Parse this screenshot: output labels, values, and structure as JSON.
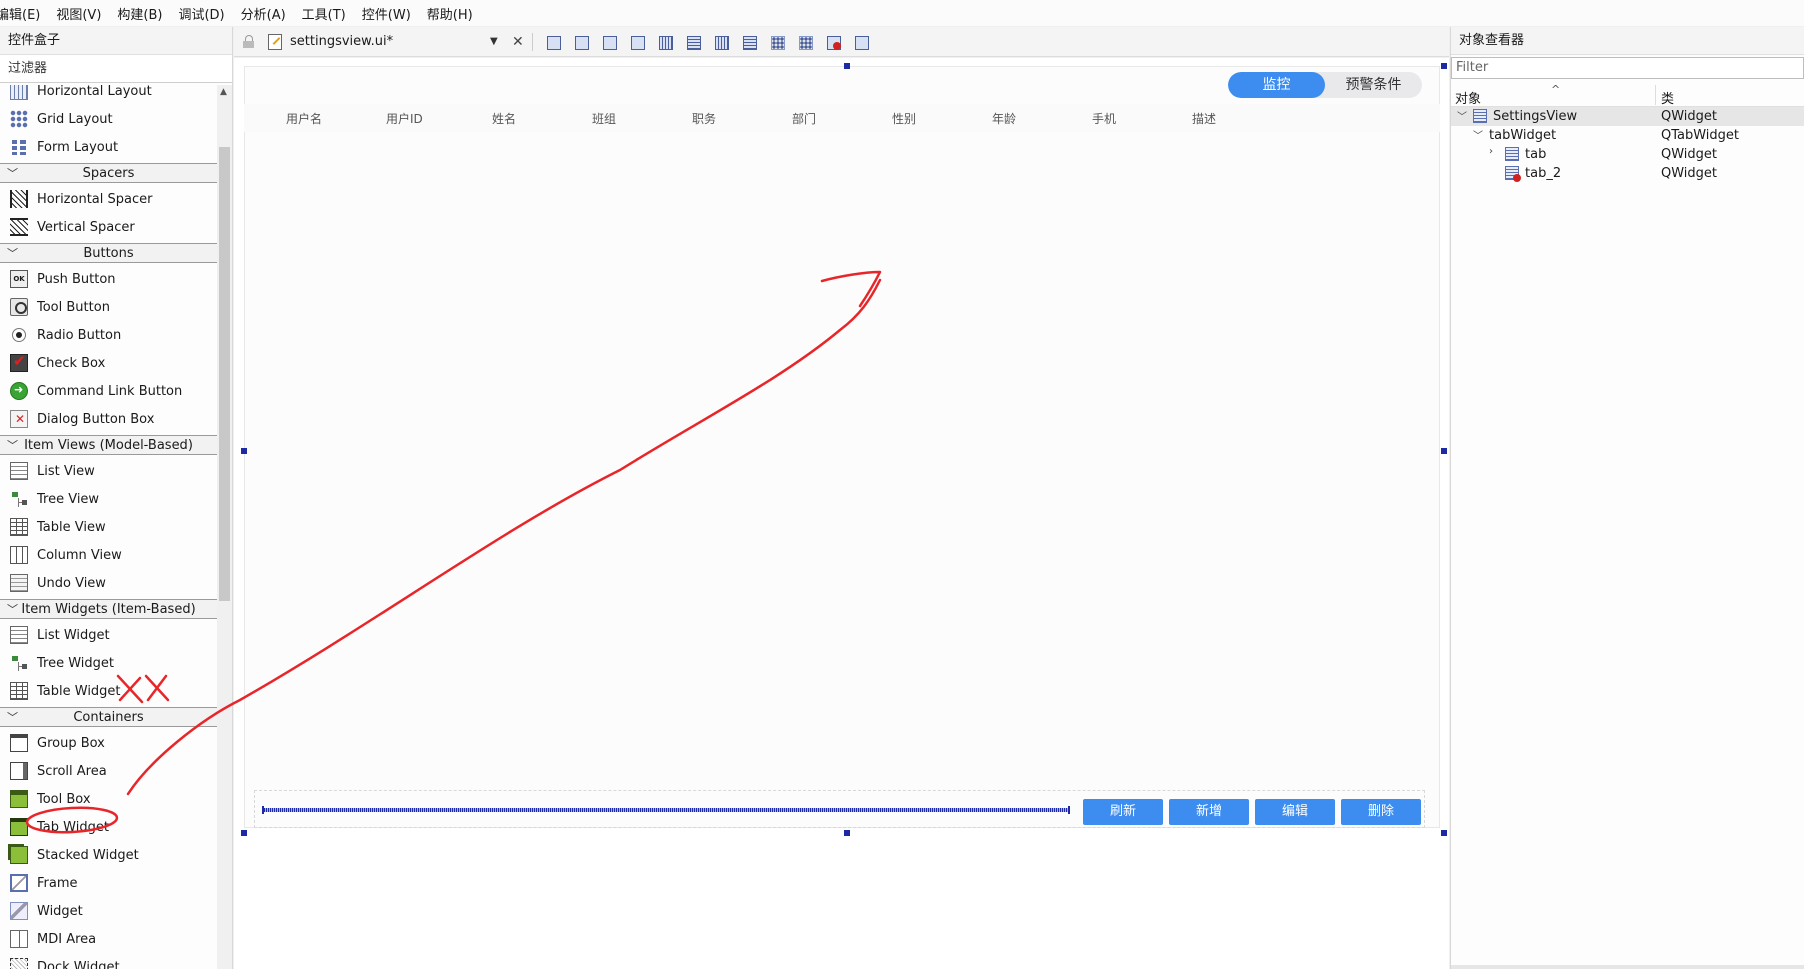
{
  "menubar": {
    "items": [
      "编辑(E)",
      "视图(V)",
      "构建(B)",
      "调试(D)",
      "分析(A)",
      "工具(T)",
      "控件(W)",
      "帮助(H)"
    ]
  },
  "widgetbox": {
    "title": "控件盒子",
    "filter_label": "过滤器",
    "groups": [
      {
        "label": null,
        "items": [
          {
            "label": "Horizontal Layout",
            "icon": "horizontal-layout-icon"
          },
          {
            "label": "Grid Layout",
            "icon": "grid-layout-icon"
          },
          {
            "label": "Form Layout",
            "icon": "form-layout-icon"
          }
        ]
      },
      {
        "label": "Spacers",
        "items": [
          {
            "label": "Horizontal Spacer",
            "icon": "horizontal-spacer-icon"
          },
          {
            "label": "Vertical Spacer",
            "icon": "vertical-spacer-icon"
          }
        ]
      },
      {
        "label": "Buttons",
        "items": [
          {
            "label": "Push Button",
            "icon": "push-button-icon"
          },
          {
            "label": "Tool Button",
            "icon": "tool-button-icon"
          },
          {
            "label": "Radio Button",
            "icon": "radio-button-icon"
          },
          {
            "label": "Check Box",
            "icon": "check-box-icon"
          },
          {
            "label": "Command Link Button",
            "icon": "command-link-icon"
          },
          {
            "label": "Dialog Button Box",
            "icon": "dialog-button-box-icon"
          }
        ]
      },
      {
        "label": "Item Views (Model-Based)",
        "items": [
          {
            "label": "List View",
            "icon": "list-view-icon"
          },
          {
            "label": "Tree View",
            "icon": "tree-view-icon"
          },
          {
            "label": "Table View",
            "icon": "table-view-icon"
          },
          {
            "label": "Column View",
            "icon": "column-view-icon"
          },
          {
            "label": "Undo View",
            "icon": "undo-view-icon"
          }
        ]
      },
      {
        "label": "Item Widgets (Item-Based)",
        "items": [
          {
            "label": "List Widget",
            "icon": "list-widget-icon"
          },
          {
            "label": "Tree Widget",
            "icon": "tree-widget-icon"
          },
          {
            "label": "Table Widget",
            "icon": "table-widget-icon"
          }
        ]
      },
      {
        "label": "Containers",
        "items": [
          {
            "label": "Group Box",
            "icon": "group-box-icon"
          },
          {
            "label": "Scroll Area",
            "icon": "scroll-area-icon"
          },
          {
            "label": "Tool Box",
            "icon": "tool-box-icon"
          },
          {
            "label": "Tab Widget",
            "icon": "tab-widget-icon"
          },
          {
            "label": "Stacked Widget",
            "icon": "stacked-widget-icon"
          },
          {
            "label": "Frame",
            "icon": "frame-icon"
          },
          {
            "label": "Widget",
            "icon": "widget-icon"
          },
          {
            "label": "MDI Area",
            "icon": "mdi-area-icon"
          },
          {
            "label": "Dock Widget",
            "icon": "dock-widget-icon"
          }
        ]
      }
    ]
  },
  "editor": {
    "file_name": "settingsview.ui*"
  },
  "form": {
    "tabs": [
      {
        "label": "监控",
        "active": true
      },
      {
        "label": "预警条件",
        "active": false
      }
    ],
    "columns": [
      "用户名",
      "用户ID",
      "姓名",
      "班组",
      "职务",
      "部门",
      "性别",
      "年龄",
      "手机",
      "描述"
    ],
    "buttons": [
      "刷新",
      "新增",
      "编辑",
      "删除"
    ],
    "accent_color": "#3d8df0",
    "selection_color": "#1c2ba5"
  },
  "inspector": {
    "title": "对象查看器",
    "filter_placeholder": "Filter",
    "col_object": "对象",
    "col_class": "类",
    "tree": [
      {
        "name": "SettingsView",
        "class": "QWidget",
        "depth": 0,
        "arrow": "﹀",
        "selected": true
      },
      {
        "name": "tabWidget",
        "class": "QTabWidget",
        "depth": 1,
        "arrow": "﹀",
        "selected": false
      },
      {
        "name": "tab",
        "class": "QWidget",
        "depth": 2,
        "arrow": "›",
        "selected": false
      },
      {
        "name": "tab_2",
        "class": "QWidget",
        "depth": 2,
        "arrow": "",
        "selected": false
      }
    ]
  },
  "annotation_color": "#e8262a"
}
